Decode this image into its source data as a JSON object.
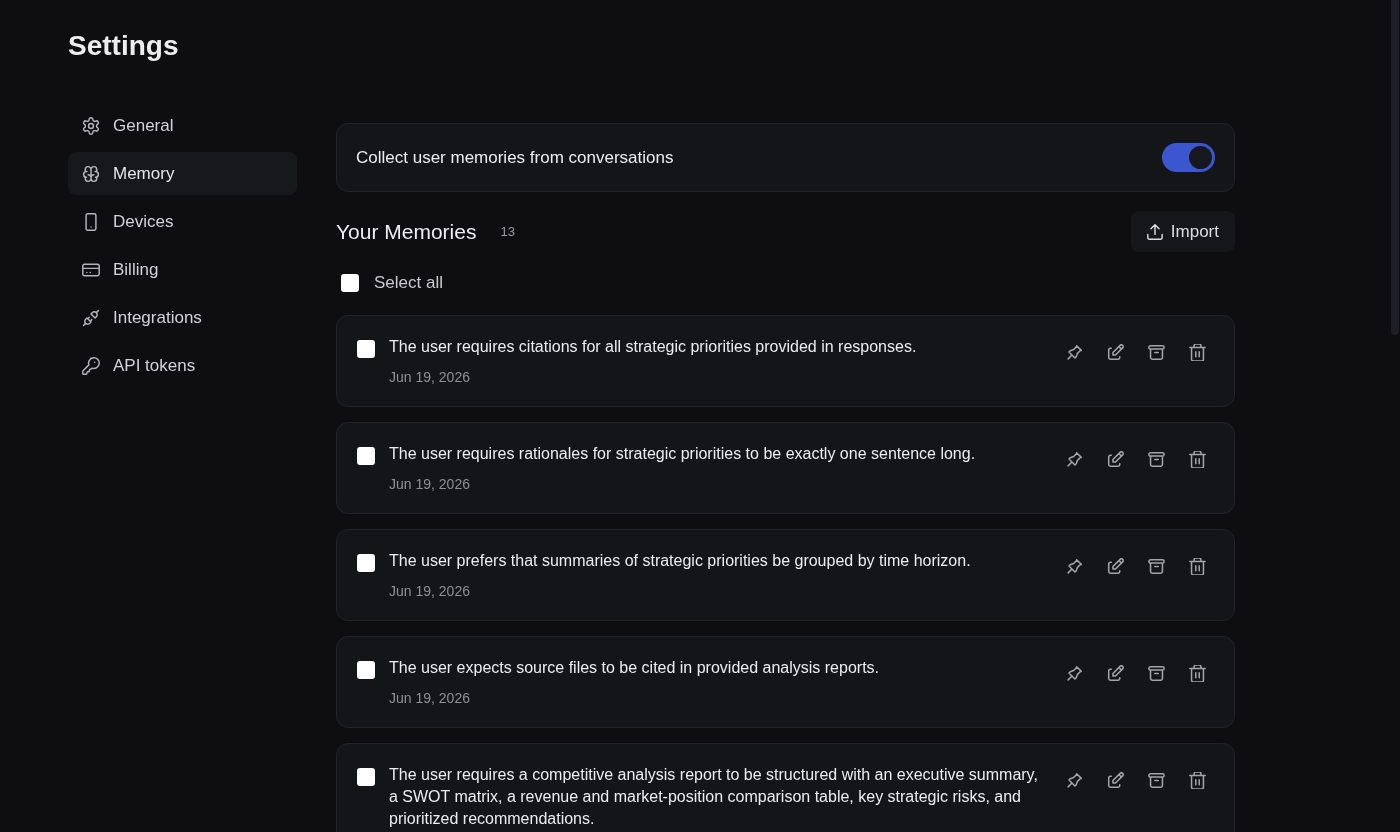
{
  "page": {
    "title": "Settings"
  },
  "sidebar": {
    "items": [
      {
        "label": "General",
        "selected": false
      },
      {
        "label": "Memory",
        "selected": true
      },
      {
        "label": "Devices",
        "selected": false
      },
      {
        "label": "Billing",
        "selected": false
      },
      {
        "label": "Integrations",
        "selected": false
      },
      {
        "label": "API tokens",
        "selected": false
      }
    ]
  },
  "collect_toggle": {
    "label": "Collect user memories from conversations",
    "on": true
  },
  "memories": {
    "title": "Your Memories",
    "count": "13",
    "import_button": "Import",
    "select_all": {
      "label": "Select all",
      "checked": false
    },
    "items": [
      {
        "text": "The user requires citations for all strategic priorities provided in responses.",
        "date": "Jun 19, 2026",
        "checked": false
      },
      {
        "text": "The user requires rationales for strategic priorities to be exactly one sentence long.",
        "date": "Jun 19, 2026",
        "checked": false
      },
      {
        "text": "The user prefers that summaries of strategic priorities be grouped by time horizon.",
        "date": "Jun 19, 2026",
        "checked": false
      },
      {
        "text": "The user expects source files to be cited in provided analysis reports.",
        "date": "Jun 19, 2026",
        "checked": false
      },
      {
        "text": "The user requires a competitive analysis report to be structured with an executive summary, a SWOT matrix, a revenue and market-position comparison table, key strategic risks, and prioritized recommendations.",
        "checked": false
      }
    ]
  }
}
